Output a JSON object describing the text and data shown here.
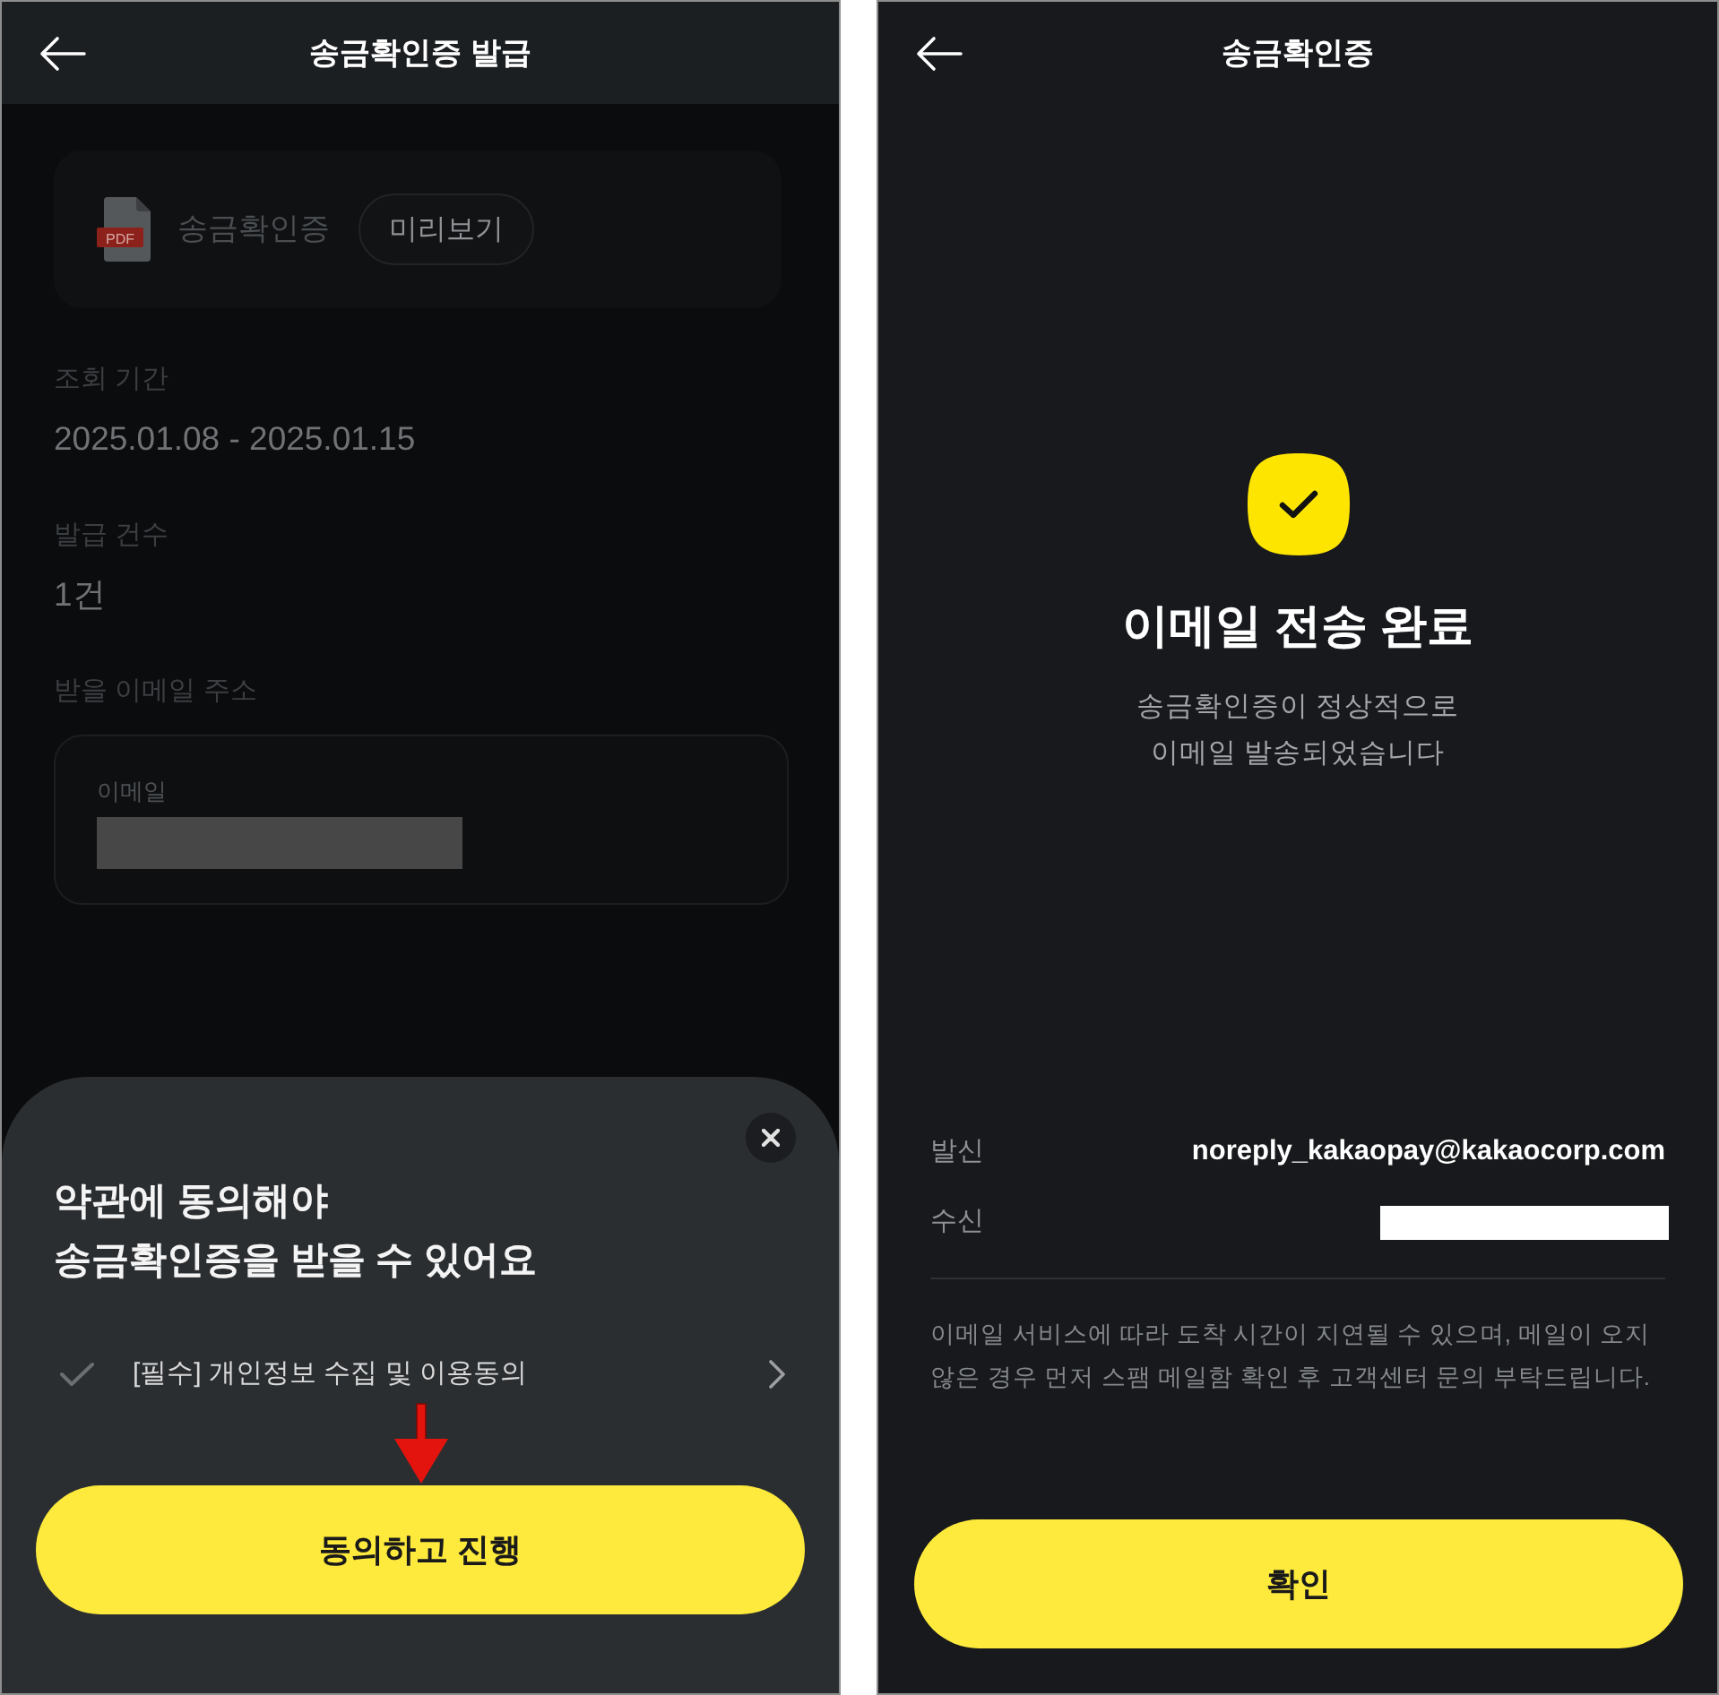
{
  "issue_screen": {
    "header": {
      "title": "송금확인증 발급"
    },
    "document_card": {
      "file_badge": "PDF",
      "name": "송금확인증",
      "preview_button": "미리보기"
    },
    "fields": [
      {
        "label": "조회 기간",
        "value": "2025.01.08 - 2025.01.15"
      },
      {
        "label": "발급 건수",
        "value": "1건"
      }
    ],
    "email": {
      "section_label": "받을 이메일 주소",
      "field_label": "이메일",
      "redacted": true
    },
    "consent_sheet": {
      "title_lines": [
        "약관에 동의해야",
        "송금확인증을 받을 수 있어요"
      ],
      "terms": [
        {
          "label": "[필수] 개인정보 수집 및 이용동의",
          "checked": false
        }
      ],
      "button": "동의하고 진행"
    }
  },
  "complete_screen": {
    "header": {
      "title": "송금확인증"
    },
    "title": "이메일 전송 완료",
    "message_lines": [
      "송금확인증이 정상적으로",
      "이메일 발송되었습니다"
    ],
    "details": [
      {
        "label": "발신",
        "value": "noreply_kakaopay@kakaocorp.com",
        "redacted": false
      },
      {
        "label": "수신",
        "redacted": true
      }
    ],
    "notice": "이메일 서비스에 따라 도착 시간이 지연될 수 있으며, 메일이 오지 않은 경우 먼저 스팸 메일함 확인 후 고객센터 문의 부탁드립니다.",
    "button": "확인"
  }
}
